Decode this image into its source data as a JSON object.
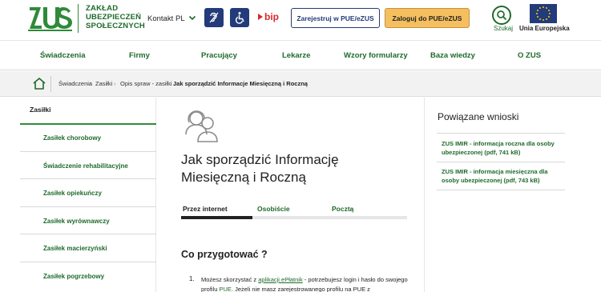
{
  "header": {
    "org_name": [
      "ZAKŁAD",
      "UBEZPIECZEŃ",
      "SPOŁECZNYCH"
    ],
    "kontakt_label": "Kontakt",
    "language": "PL",
    "accessibility_icons": [
      "hearing-impaired-icon",
      "wheelchair-icon"
    ],
    "bip_label": "bip",
    "register_button": "Zarejestruj w PUE/eZUS",
    "login_button": "Zaloguj do PUE/eZUS",
    "search_label": "Szukaj",
    "eu_label": "Unia Europejska"
  },
  "mainnav": {
    "items": [
      "Świadczenia",
      "Firmy",
      "Pracujący",
      "Lekarze",
      "Wzory formularzy",
      "Baza wiedzy",
      "O ZUS"
    ]
  },
  "breadcrumb": {
    "items": [
      "Świadczenia",
      "Zasiłki",
      "Opis spraw - zasiłki",
      "Jak sporządzić Informacje Miesięczną i Roczną"
    ]
  },
  "sidebar": {
    "heading": "Zasiłki",
    "items": [
      "Zasiłek chorobowy",
      "Świadczenie rehabilitacyjne",
      "Zasiłek opiekuńczy",
      "Zasiłek wyrównawczy",
      "Zasiłek macierzyński",
      "Zasiłek pogrzebowy"
    ]
  },
  "content": {
    "title_lines": [
      "Jak sporządzić Informację",
      "Miesięczną i Roczną"
    ],
    "tabs": [
      "Przez internet",
      "Osobiście",
      "Pocztą"
    ],
    "section_title": "Co przygotować ?",
    "step": {
      "number": "1.",
      "text_1": "Możesz skorzystać z ",
      "link_1": "aplikacji ePłatnik",
      "text_2": " - potrzebujesz login i hasło do swojego profilu ",
      "link_2": "PUE",
      "text_3": ". Jeżeli nie masz zarejestrowanego profilu na PUE z"
    }
  },
  "related": {
    "title": "Powiązane wnioski",
    "links": [
      "ZUS IMIR - informacja roczna dla osoby ubezpieczonej (pdf, 741 kB)",
      "ZUS IMIR - informacja miesięczna dla osoby ubezpieczonej (pdf, 743 kB)"
    ]
  },
  "colors": {
    "brand_green": "#1e6a2b",
    "navy": "#233b7a",
    "login_yellow": "#f5bf5f",
    "bip_red": "#d7282f"
  }
}
